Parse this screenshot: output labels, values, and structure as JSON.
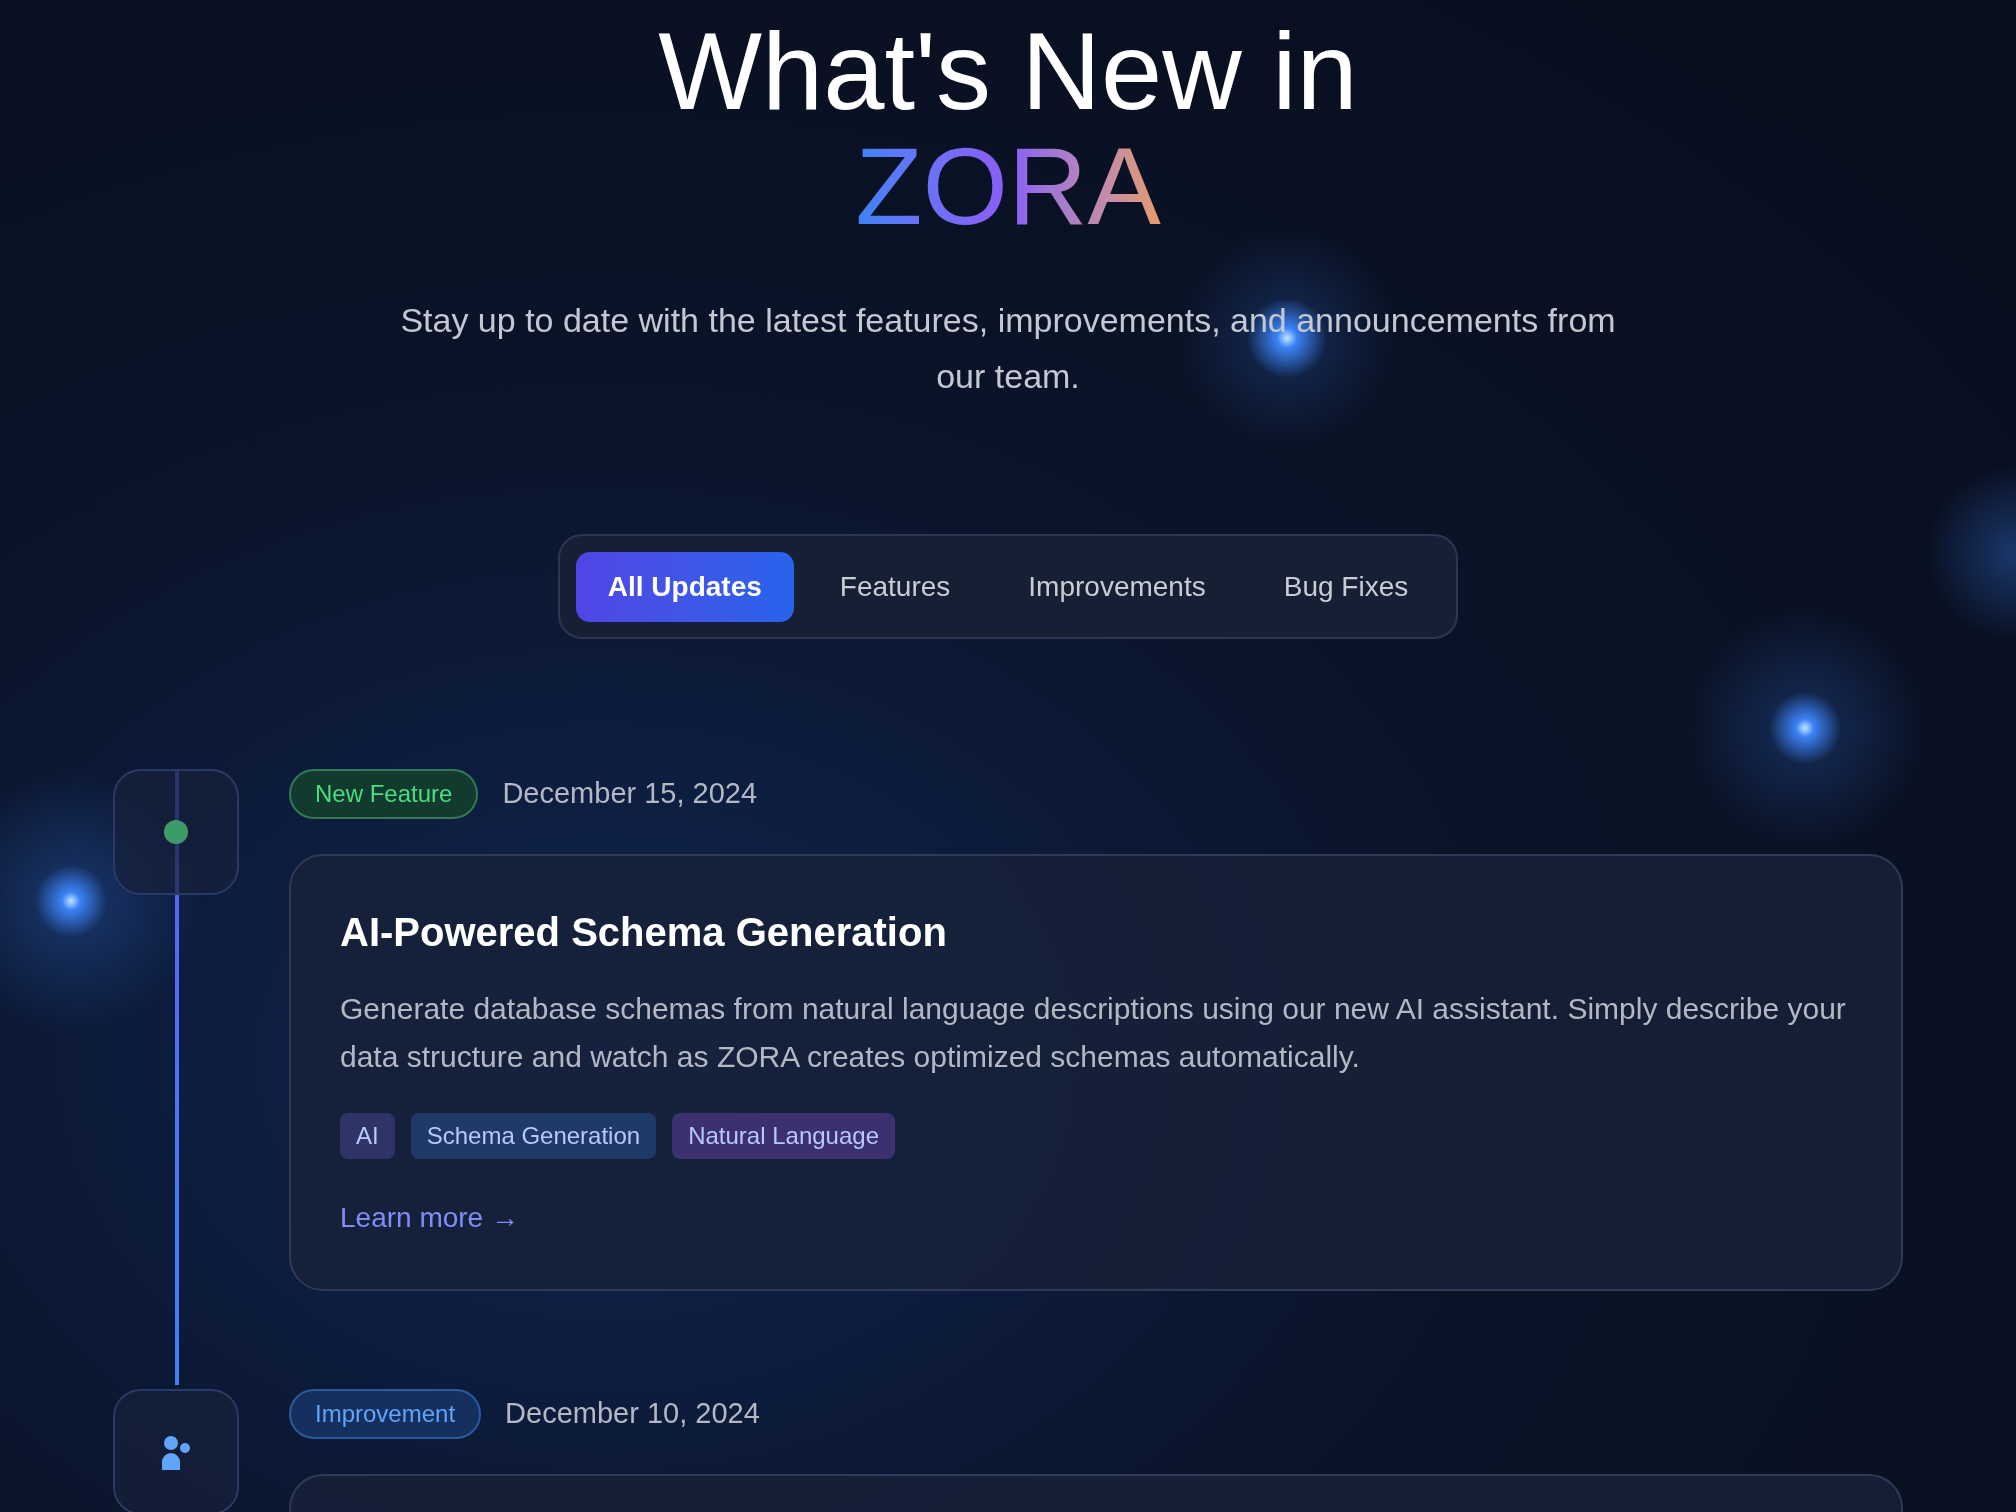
{
  "hero": {
    "title_line": "What's New in",
    "brand": "ZORA",
    "subtitle": "Stay up to date with the latest features, improvements, and announcements from our team."
  },
  "tabs": [
    {
      "label": "All Updates",
      "selected": true
    },
    {
      "label": "Features",
      "selected": false
    },
    {
      "label": "Improvements",
      "selected": false
    },
    {
      "label": "Bug Fixes",
      "selected": false
    }
  ],
  "updates": [
    {
      "kind": "feature",
      "badge": "New Feature",
      "date": "December 15, 2024",
      "title": "AI-Powered Schema Generation",
      "description": "Generate database schemas from natural language descriptions using our new AI assistant. Simply describe your data structure and watch as ZORA creates optimized schemas automatically.",
      "tags": [
        {
          "label": "AI",
          "color": "#2e3566"
        },
        {
          "label": "Schema Generation",
          "color": "#1f3a68"
        },
        {
          "label": "Natural Language",
          "color": "#3d3070"
        }
      ],
      "link": "Learn more →"
    },
    {
      "kind": "improvement",
      "badge": "Improvement",
      "date": "December 10, 2024"
    }
  ]
}
